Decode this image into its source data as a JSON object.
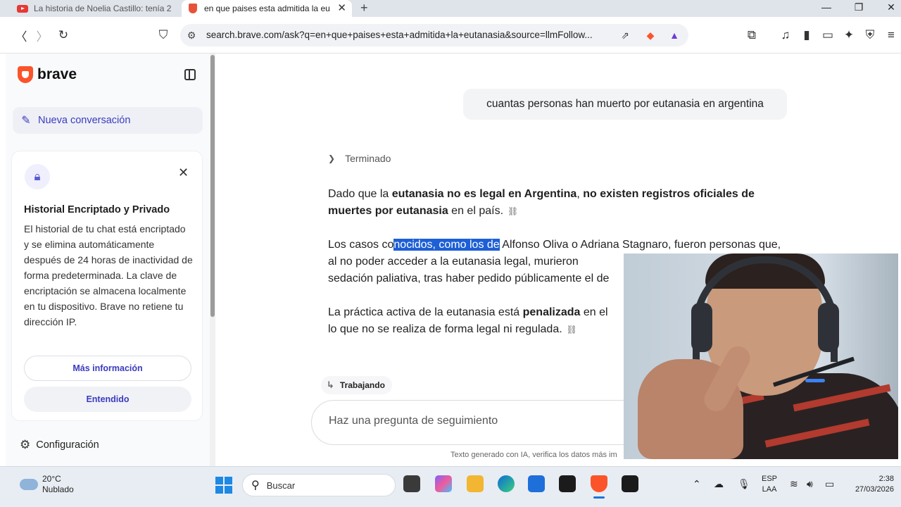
{
  "tabs": [
    {
      "title": "La historia de Noelia Castillo: tenía 23",
      "icon": "youtube-icon"
    },
    {
      "title": "en que paises esta admitida la eu",
      "icon": "brave-search-icon",
      "active": true
    }
  ],
  "toolbar": {
    "url": "search.brave.com/ask?q=en+que+paises+esta+admitida+la+eutanasia&source=llmFollow..."
  },
  "sidebar": {
    "brand": "brave",
    "new_conversation": "Nueva conversación",
    "card": {
      "title": "Historial Encriptado y Privado",
      "body": "El historial de tu chat está encriptado y se elimina automáticamente después de 24 horas de inactividad de forma predeterminada. La clave de encriptación se almacena localmente en tu dispositivo. Brave no retiene tu dirección IP.",
      "more_info": "Más información",
      "understood": "Entendido"
    },
    "settings": "Configuración"
  },
  "chat": {
    "user_query": "cuantas personas han muerto por eutanasia en argentina",
    "status": "Terminado",
    "p1": {
      "t1": "Dado que la ",
      "b1": "eutanasia no es legal en Argentina",
      "t2": ", ",
      "b2": "no existen registros oficiales de muertes por eutanasia",
      "t3": " en el país."
    },
    "p2": {
      "t1": "Los casos co",
      "highlight": "nocidos, como los de",
      "t2": " Alfonso Oliva o Adriana Stagnaro, fueron personas que, al no poder acceder a la eutanasia legal, murieron",
      "t3": "sedación paliativa, tras haber pedido públicamente el de"
    },
    "p3": {
      "t1": "La práctica activa de la eutanasia está ",
      "b1": "penalizada",
      "t2": " en el",
      "t3": "lo que no se realiza de forma legal ni regulada."
    },
    "working": "Trabajando",
    "followup_placeholder": "Haz una pregunta de seguimiento",
    "disclaimer": "Texto generado con IA, verifica los datos más im"
  },
  "taskbar": {
    "temperature": "20°C",
    "weather": "Nublado",
    "search": "Buscar",
    "lang": "ESP",
    "layout": "LAA",
    "time": "2:38",
    "date": "27/03/2026"
  }
}
